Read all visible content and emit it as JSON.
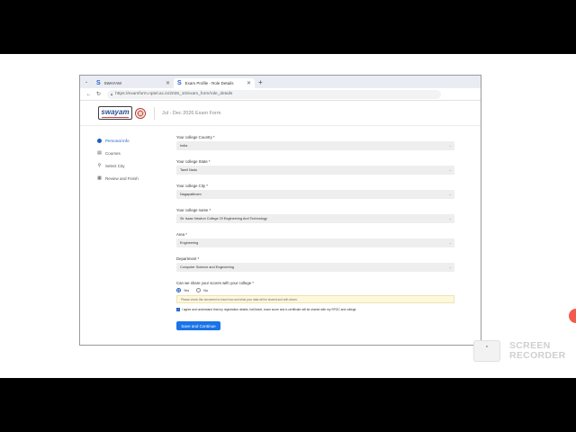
{
  "browser": {
    "tabs": [
      {
        "label": "SWAYAM",
        "favicon": "S"
      },
      {
        "label": "Exam Profile - Role Details",
        "favicon": "S"
      }
    ],
    "new_tab": "+",
    "url": "https://examform.nptel.ac.in/2026_10/exam_form/role_details"
  },
  "header": {
    "logo_text": "swayam",
    "title": "Jul - Dec 2026 Exam Form"
  },
  "sidebar": {
    "items": [
      {
        "label": "Personal Info",
        "icon": "user-icon",
        "active": true
      },
      {
        "label": "Courses",
        "icon": "book-icon",
        "active": false
      },
      {
        "label": "Select City",
        "icon": "location-pin-icon",
        "active": false
      },
      {
        "label": "Review and Finish",
        "icon": "list-icon",
        "active": false
      }
    ]
  },
  "form": {
    "fields": [
      {
        "label": "Your college Country *",
        "value": "India"
      },
      {
        "label": "Your college State *",
        "value": "Tamil Nadu"
      },
      {
        "label": "Your college City *",
        "value": "Nagapattinam"
      },
      {
        "label": "Your college name *",
        "value": "Sir Isaac Newton College Of Engineering And Technology"
      },
      {
        "label": "Area *",
        "value": "Engineering"
      },
      {
        "label": "Department *",
        "value": "Computer Science and Engineering"
      }
    ],
    "share_question": "Can we share your scores with your college *",
    "share_options": [
      "Yes",
      "No"
    ],
    "share_selected": "Yes",
    "notice": "Please check this document to know how and what your data will be shared and with whom.",
    "consent": "I agree and understand that my registration details, hall ticket, exam score and e-certificate will be shared with my SPOC and college.",
    "submit_label": "Save and Continue"
  },
  "watermark": {
    "line1": "SCREEN",
    "line2": "RECORDER"
  },
  "colors": {
    "primary": "#1a73e8",
    "active_nav": "#1f5fbf",
    "recorder_dot": "#f15b4d"
  }
}
